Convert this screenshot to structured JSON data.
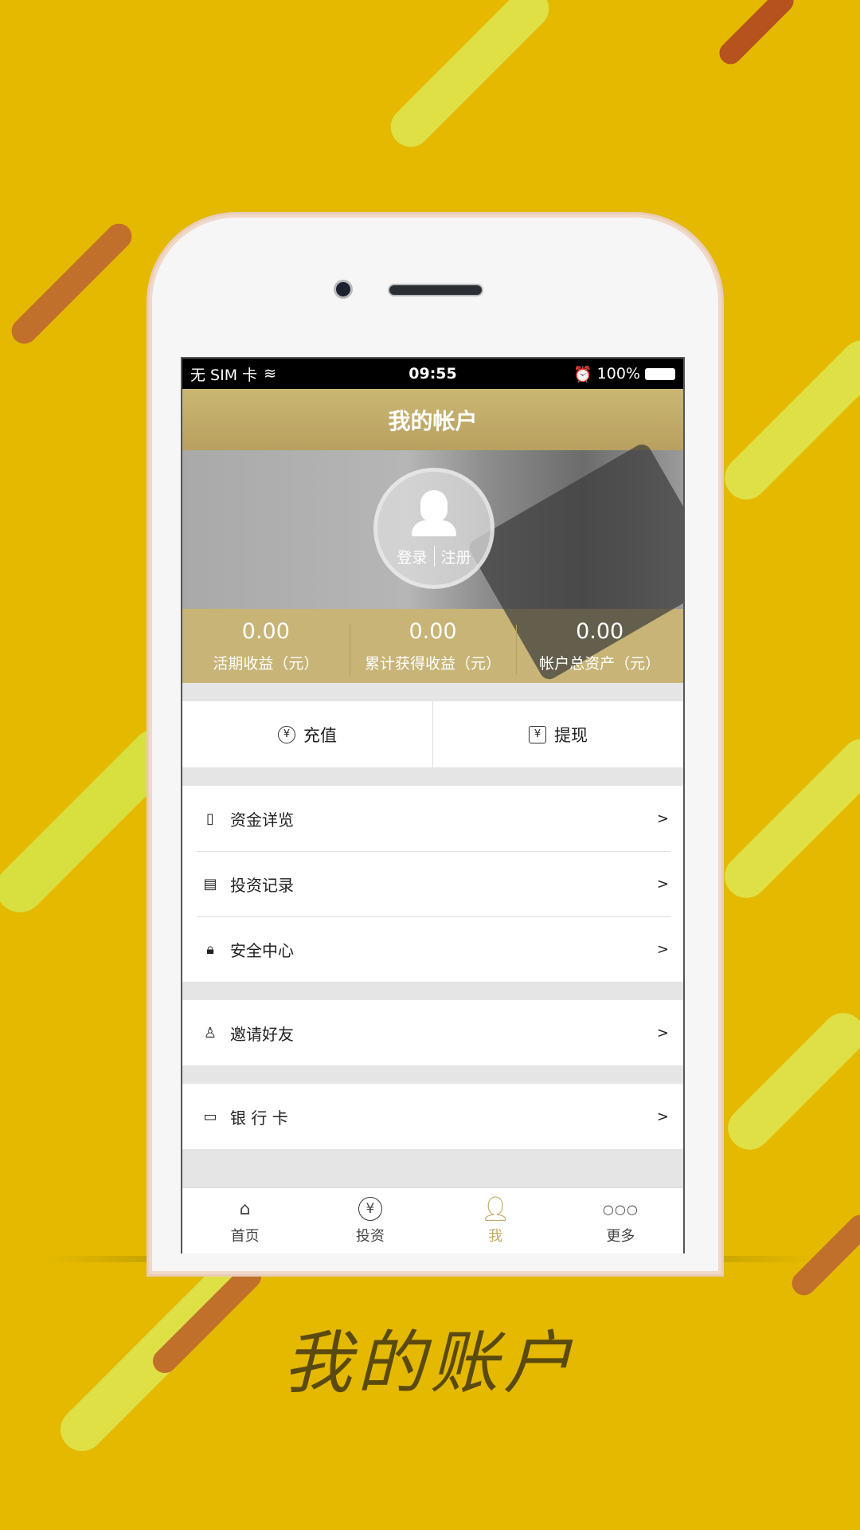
{
  "colors": {
    "background": "#e5b900",
    "accent": "#c7b476",
    "header": "#bfa865"
  },
  "status_bar": {
    "carrier": "无 SIM 卡",
    "time": "09:55",
    "battery": "100%"
  },
  "header": {
    "title": "我的帐户"
  },
  "profile": {
    "login": "登录",
    "register": "注册"
  },
  "stats": [
    {
      "value": "0.00",
      "label": "活期收益（元）"
    },
    {
      "value": "0.00",
      "label": "累计获得收益（元）"
    },
    {
      "value": "0.00",
      "label": "帐户总资产（元）"
    }
  ],
  "actions": [
    {
      "label": "充值",
      "icon": "yen-circle-icon"
    },
    {
      "label": "提现",
      "icon": "yen-square-icon"
    }
  ],
  "menu_groups": [
    [
      {
        "label": "资金详览",
        "icon": "book-icon"
      },
      {
        "label": "投资记录",
        "icon": "record-icon"
      },
      {
        "label": "安全中心",
        "icon": "lock-icon"
      }
    ],
    [
      {
        "label": "邀请好友",
        "icon": "person-icon"
      }
    ],
    [
      {
        "label": "银 行 卡",
        "icon": "card-icon"
      }
    ]
  ],
  "chevron": ">",
  "tabs": [
    {
      "label": "首页",
      "icon": "home-icon"
    },
    {
      "label": "投资",
      "icon": "yen-icon"
    },
    {
      "label": "我",
      "icon": "user-icon",
      "active": true
    },
    {
      "label": "更多",
      "icon": "more-icon"
    }
  ],
  "caption": "我的账户"
}
